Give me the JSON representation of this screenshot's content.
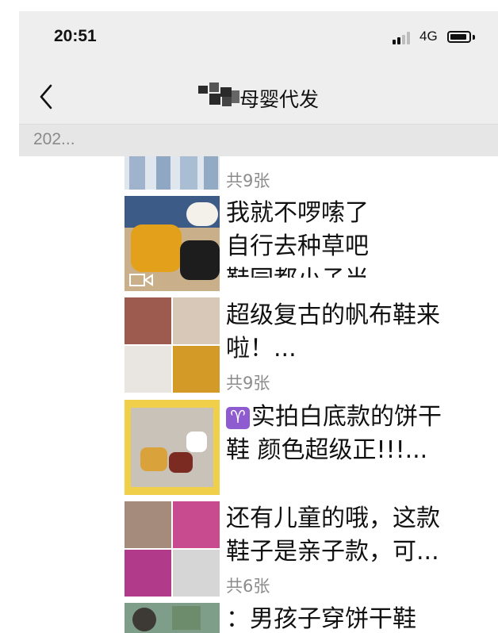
{
  "status_bar": {
    "time": "20:51",
    "network": "4G"
  },
  "nav": {
    "title": "母婴代发"
  },
  "date_header": "202...",
  "posts": [
    {
      "count": "共9张"
    },
    {
      "lines": [
        "我就不啰嗦了",
        "自行去种草吧",
        "鞋园都小子当"
      ]
    },
    {
      "lines": [
        "超级复古的帆布鞋来",
        "啦！..."
      ],
      "count": "共9张"
    },
    {
      "emoji": "♈",
      "lines": [
        "实拍白底款的饼干",
        "鞋 颜色超级正!!!..."
      ]
    },
    {
      "lines": [
        "还有儿童的哦，这款",
        "鞋子是亲子款，可..."
      ],
      "count": "共6张"
    },
    {
      "lines": [
        "：男孩子穿饼干鞋"
      ]
    }
  ],
  "colors": {
    "bar_bg": "#eeeeee",
    "date_bg": "#e6e6e6",
    "count_text": "#8c8c8c",
    "zodiac_bg": "#8e5bd1"
  }
}
